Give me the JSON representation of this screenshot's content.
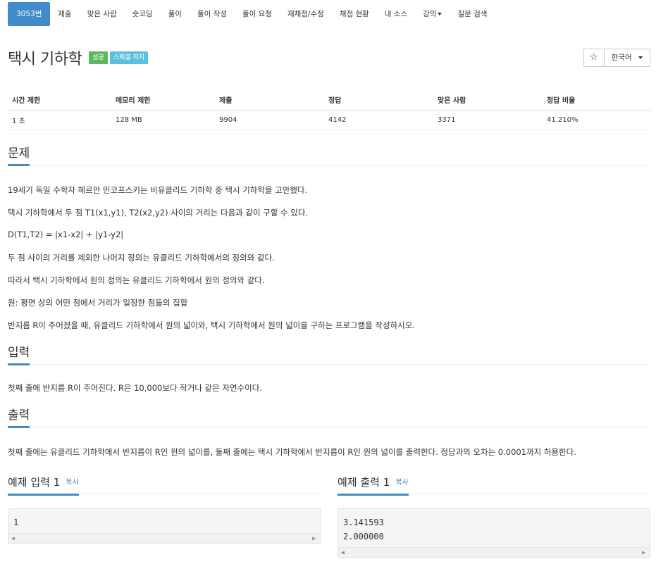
{
  "nav": [
    {
      "label": "3053번",
      "active": true
    },
    {
      "label": "제출"
    },
    {
      "label": "맞은 사람"
    },
    {
      "label": "숏코딩"
    },
    {
      "label": "풀이"
    },
    {
      "label": "풀이 작성"
    },
    {
      "label": "풀이 요청"
    },
    {
      "label": "재채점/수정"
    },
    {
      "label": "채점 현황"
    },
    {
      "label": "내 소스"
    },
    {
      "label": "강의",
      "dropdown": true
    },
    {
      "label": "질문 검색"
    }
  ],
  "problem": {
    "title": "택시 기하학",
    "badges": [
      "성공",
      "스페셜 저지"
    ],
    "star": "☆",
    "language": "한국어"
  },
  "stats": {
    "headers": [
      "시간 제한",
      "메모리 제한",
      "제출",
      "정답",
      "맞은 사람",
      "정답 비율"
    ],
    "values": [
      "1 초",
      "128 MB",
      "9904",
      "4142",
      "3371",
      "41.210%"
    ]
  },
  "sections": {
    "problem_title": "문제",
    "problem_lines": [
      "19세기 독일 수학자 헤르만 민코프스키는 비유클리드 기하학 중 택시 기하학을 고안했다.",
      "택시 기하학에서 두 점 T1(x1,y1), T2(x2,y2) 사이의 거리는 다음과 같이 구할 수 있다.",
      "D(T1,T2) = |x1-x2| + |y1-y2|",
      "두 점 사이의 거리를 제외한 나머지 정의는 유클리드 기하학에서의 정의와 같다.",
      "따라서 택시 기하학에서 원의 정의는 유클리드 기하학에서 원의 정의와 같다.",
      "원: 평면 상의 어떤 점에서 거리가 일정한 점들의 집합",
      "반지름 R이 주어졌을 때, 유클리드 기하학에서 원의 넓이와, 택시 기하학에서 원의 넓이를 구하는 프로그램을 작성하시오."
    ],
    "input_title": "입력",
    "input_text": "첫째 줄에 반지름 R이 주어진다. R은 10,000보다 작거나 같은 자연수이다.",
    "output_title": "출력",
    "output_text": "첫째 줄에는 유클리드 기하학에서 반지름이 R인 원의 넓이를, 둘째 줄에는 택시 기하학에서 반지름이 R인 원의 넓이를 출력한다. 정답과의 오차는 0.0001까지 허용한다."
  },
  "samples": {
    "input_title": "예제 입력 1",
    "output_title": "예제 출력 1",
    "copy_label": "복사",
    "input_text": "1",
    "output_lines": [
      "3.141593",
      "2.000000"
    ]
  },
  "colors": {
    "primary": "#428bca",
    "success": "#5cb85c",
    "info": "#5bc0de"
  }
}
